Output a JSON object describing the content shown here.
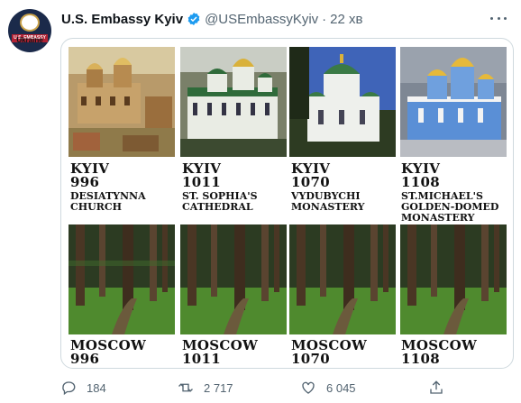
{
  "tweet": {
    "account_label": "Ukraine",
    "avatar_banner": "U.S. EMBASSY",
    "display_name": "U.S. Embassy Kyiv",
    "handle": "@USEmbassyKyiv",
    "separator": "·",
    "time": "22 хв"
  },
  "image": {
    "top_row": [
      {
        "city": "KYIV",
        "year": "996",
        "line1": "DESIATYNNA",
        "line2": "CHURCH",
        "line3": ""
      },
      {
        "city": "KYIV",
        "year": "1011",
        "line1": "ST. SOPHIA'S",
        "line2": "CATHEDRAL",
        "line3": ""
      },
      {
        "city": "KYIV",
        "year": "1070",
        "line1": "VYDUBYCHI",
        "line2": "MONASTERY",
        "line3": ""
      },
      {
        "city": "KYIV",
        "year": "1108",
        "line1": "ST.MICHAEL'S",
        "line2": "GOLDEN-DOMED",
        "line3": "MONASTERY"
      }
    ],
    "bottom_row": [
      {
        "city": "MOSCOW",
        "year": "996"
      },
      {
        "city": "MOSCOW",
        "year": "1011"
      },
      {
        "city": "MOSCOW",
        "year": "1070"
      },
      {
        "city": "MOSCOW",
        "year": "1108"
      }
    ]
  },
  "actions": {
    "replies": "184",
    "retweets": "2 717",
    "likes": "6 045"
  },
  "colors": {
    "verified": "#1d9bf0",
    "muted": "#536471",
    "border": "#cfd9de",
    "forest": "#3f6b2c"
  },
  "icons": {
    "verified": "verified-badge-icon",
    "more": "more-icon",
    "reply": "reply-icon",
    "retweet": "retweet-icon",
    "like": "heart-icon",
    "share": "share-icon"
  }
}
